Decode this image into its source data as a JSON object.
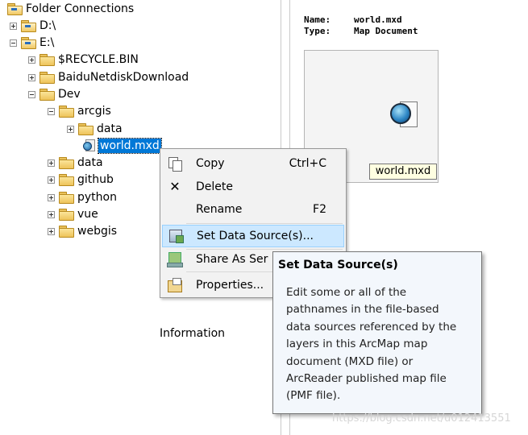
{
  "tree": {
    "root_label": "Folder Connections",
    "items": [
      {
        "label": "D:\\"
      },
      {
        "label": "E:\\"
      },
      {
        "label": "$RECYCLE.BIN"
      },
      {
        "label": "BaiduNetdiskDownload"
      },
      {
        "label": "Dev"
      },
      {
        "label": "arcgis"
      },
      {
        "label": "data"
      },
      {
        "label": "world.mxd"
      },
      {
        "label": "data"
      },
      {
        "label": "github"
      },
      {
        "label": "python"
      },
      {
        "label": "vue"
      },
      {
        "label": "webgis"
      }
    ]
  },
  "details": {
    "name_key": "Name:",
    "name_value": "world.mxd",
    "type_key": "Type:",
    "type_value": "Map Document",
    "preview_label": "world.mxd"
  },
  "info_label": "Information",
  "context_menu": {
    "items": [
      {
        "label": "Copy",
        "shortcut": "Ctrl+C",
        "icon": "copy-icon"
      },
      {
        "label": "Delete",
        "shortcut": "",
        "icon": "delete-icon"
      },
      {
        "label": "Rename",
        "shortcut": "F2",
        "icon": ""
      },
      {
        "label": "Set Data Source(s)...",
        "shortcut": "",
        "icon": "data-source-icon",
        "highlighted": true
      },
      {
        "label": "Share As Ser",
        "shortcut": "",
        "icon": "share-icon"
      },
      {
        "label": "Properties...",
        "shortcut": "",
        "icon": "properties-icon"
      }
    ]
  },
  "tooltip": {
    "title": "Set Data Source(s)",
    "body": "Edit some or all of the\npathnames in the file-based\ndata sources referenced by the\nlayers in this ArcMap map\ndocument (MXD file) or\nArcReader published map file\n(PMF file)."
  },
  "watermark": "https://blog.csdn.net/u012413551"
}
